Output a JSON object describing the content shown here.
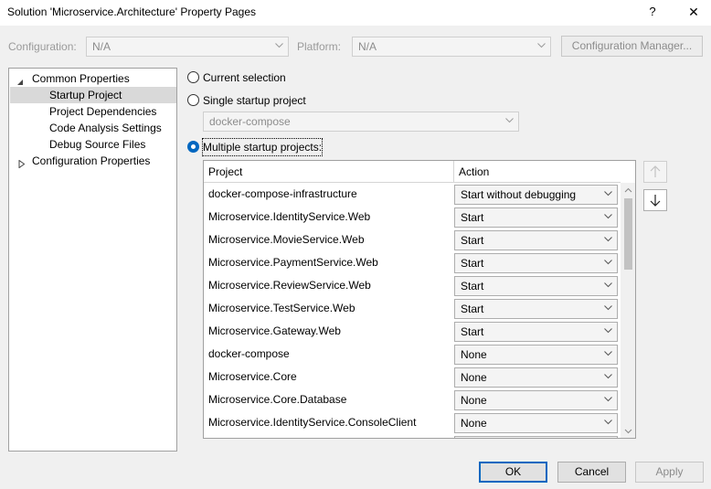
{
  "window": {
    "title": "Solution 'Microservice.Architecture' Property Pages",
    "help_glyph": "?",
    "close_glyph": "✕"
  },
  "toolbar": {
    "configuration_label": "Configuration:",
    "configuration_value": "N/A",
    "platform_label": "Platform:",
    "platform_value": "N/A",
    "config_manager_label": "Configuration Manager..."
  },
  "tree": {
    "items": [
      {
        "label": "Common Properties",
        "expanded": true
      },
      {
        "label": "Startup Project",
        "selected": true
      },
      {
        "label": "Project Dependencies"
      },
      {
        "label": "Code Analysis Settings"
      },
      {
        "label": "Debug Source Files"
      },
      {
        "label": "Configuration Properties",
        "expanded": false
      }
    ]
  },
  "startup": {
    "current_selection_label": "Current selection",
    "single_label": "Single startup project",
    "single_value": "docker-compose",
    "multiple_label": "Multiple startup projects:",
    "selected_option": "multiple"
  },
  "grid": {
    "columns": [
      "Project",
      "Action"
    ],
    "rows": [
      {
        "project": "docker-compose-infrastructure",
        "action": "Start without debugging"
      },
      {
        "project": "Microservice.IdentityService.Web",
        "action": "Start"
      },
      {
        "project": "Microservice.MovieService.Web",
        "action": "Start"
      },
      {
        "project": "Microservice.PaymentService.Web",
        "action": "Start"
      },
      {
        "project": "Microservice.ReviewService.Web",
        "action": "Start"
      },
      {
        "project": "Microservice.TestService.Web",
        "action": "Start"
      },
      {
        "project": "Microservice.Gateway.Web",
        "action": "Start"
      },
      {
        "project": "docker-compose",
        "action": "None"
      },
      {
        "project": "Microservice.Core",
        "action": "None"
      },
      {
        "project": "Microservice.Core.Database",
        "action": "None"
      },
      {
        "project": "Microservice.IdentityService.ConsoleClient",
        "action": "None"
      },
      {
        "project": "",
        "action": ""
      }
    ]
  },
  "buttons": {
    "ok": "OK",
    "cancel": "Cancel",
    "apply": "Apply"
  },
  "icons": {
    "move_up": "arrow-up-icon",
    "move_down": "arrow-down-icon",
    "chevron": "chevron-down-icon"
  },
  "colors": {
    "accent": "#0067c0",
    "window_bg": "#f0f0f0",
    "selected_tree_bg": "#d9d9d9"
  }
}
